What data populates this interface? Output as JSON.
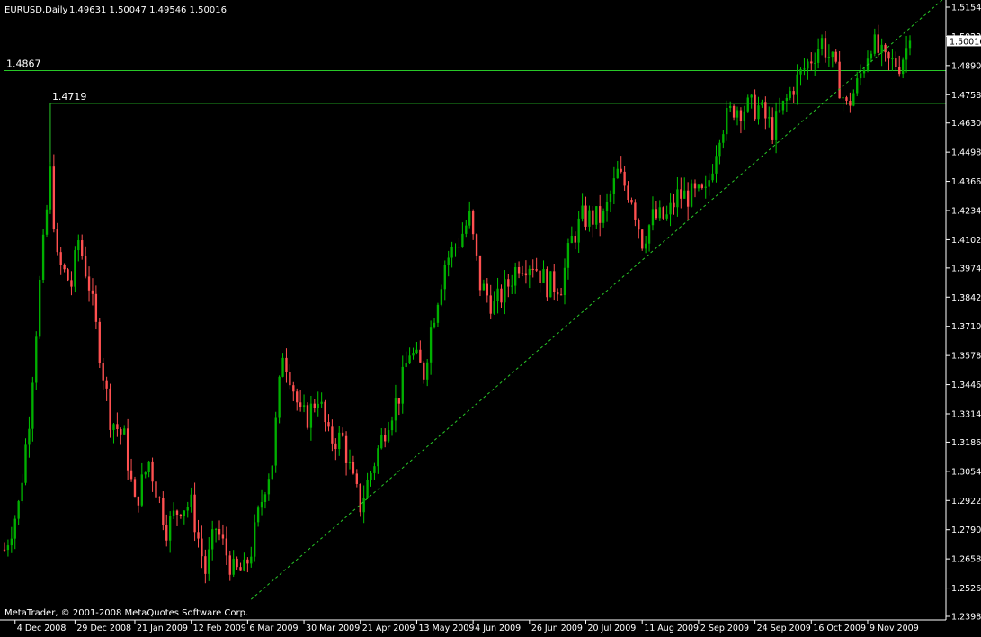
{
  "header": {
    "symbol_label": "EURUSD,Daily",
    "ohlc": "1.49631 1.50047 1.49546 1.50016"
  },
  "footer": {
    "copyright": "MetaTrader, © 2001-2008 MetaQuotes Software Corp."
  },
  "colors": {
    "background": "#000000",
    "bull_candle": "#00b000",
    "bear_candle": "#ff5050",
    "wick_bull": "#00c800",
    "wick_bear": "#ff5050",
    "axis": "#ffffff",
    "hline": "#28c828",
    "trendline": "#28c828"
  },
  "chart_data": {
    "type": "candlestick",
    "symbol": "EURUSD",
    "timeframe": "Daily",
    "last_price": "1.50016",
    "ylim": [
      1.2398,
      1.5154
    ],
    "y_ticks": [
      "1.51540",
      "1.50220",
      "1.48900",
      "1.47580",
      "1.46300",
      "1.44980",
      "1.43660",
      "1.42340",
      "1.41020",
      "1.39740",
      "1.38420",
      "1.37100",
      "1.35780",
      "1.34460",
      "1.33140",
      "1.31860",
      "1.30540",
      "1.29220",
      "1.27900",
      "1.26580",
      "1.25260",
      "1.23980"
    ],
    "x_ticks": [
      "4 Dec 2008",
      "29 Dec 2008",
      "21 Jan 2009",
      "12 Feb 2009",
      "6 Mar 2009",
      "30 Mar 2009",
      "21 Apr 2009",
      "13 May 2009",
      "4 Jun 2009",
      "26 Jun 2009",
      "20 Jul 2009",
      "11 Aug 2009",
      "2 Sep 2009",
      "24 Sep 2009",
      "16 Oct 2009",
      "9 Nov 2009"
    ],
    "horizontal_lines": [
      {
        "label": "1.4867",
        "price": 1.4867,
        "start_date": "1 Dec 2008"
      },
      {
        "label": "1.4719",
        "price": 1.4719,
        "start_date": "18 Dec 2008"
      }
    ],
    "trendline": {
      "style": "dashed",
      "from": {
        "date": "9 Mar 2009",
        "price": 1.2475
      },
      "to": {
        "date": "25 Nov 2009",
        "price": 1.506
      }
    },
    "close_path": [
      {
        "date": "1 Dec 2008",
        "close": 1.27
      },
      {
        "date": "5 Dec 2008",
        "close": 1.29
      },
      {
        "date": "10 Dec 2008",
        "close": 1.33
      },
      {
        "date": "15 Dec 2008",
        "close": 1.39
      },
      {
        "date": "18 Dec 2008",
        "close": 1.44
      },
      {
        "date": "22 Dec 2008",
        "close": 1.4
      },
      {
        "date": "26 Dec 2008",
        "close": 1.39
      },
      {
        "date": "30 Dec 2008",
        "close": 1.41
      },
      {
        "date": "2 Jan 2009",
        "close": 1.39
      },
      {
        "date": "7 Jan 2009",
        "close": 1.36
      },
      {
        "date": "12 Jan 2009",
        "close": 1.33
      },
      {
        "date": "16 Jan 2009",
        "close": 1.32
      },
      {
        "date": "21 Jan 2009",
        "close": 1.29
      },
      {
        "date": "27 Jan 2009",
        "close": 1.31
      },
      {
        "date": "3 Feb 2009",
        "close": 1.28
      },
      {
        "date": "9 Feb 2009",
        "close": 1.29
      },
      {
        "date": "12 Feb 2009",
        "close": 1.29
      },
      {
        "date": "18 Feb 2009",
        "close": 1.26
      },
      {
        "date": "23 Feb 2009",
        "close": 1.28
      },
      {
        "date": "2 Mar 2009",
        "close": 1.26
      },
      {
        "date": "5 Mar 2009",
        "close": 1.26
      },
      {
        "date": "9 Mar 2009",
        "close": 1.27
      },
      {
        "date": "13 Mar 2009",
        "close": 1.3
      },
      {
        "date": "17 Mar 2009",
        "close": 1.31
      },
      {
        "date": "20 Mar 2009",
        "close": 1.36
      },
      {
        "date": "24 Mar 2009",
        "close": 1.35
      },
      {
        "date": "27 Mar 2009",
        "close": 1.33
      },
      {
        "date": "31 Mar 2009",
        "close": 1.33
      },
      {
        "date": "3 Apr 2009",
        "close": 1.34
      },
      {
        "date": "8 Apr 2009",
        "close": 1.32
      },
      {
        "date": "14 Apr 2009",
        "close": 1.32
      },
      {
        "date": "17 Apr 2009",
        "close": 1.3
      },
      {
        "date": "21 Apr 2009",
        "close": 1.29
      },
      {
        "date": "27 Apr 2009",
        "close": 1.31
      },
      {
        "date": "1 May 2009",
        "close": 1.33
      },
      {
        "date": "6 May 2009",
        "close": 1.34
      },
      {
        "date": "11 May 2009",
        "close": 1.36
      },
      {
        "date": "15 May 2009",
        "close": 1.35
      },
      {
        "date": "19 May 2009",
        "close": 1.37
      },
      {
        "date": "25 May 2009",
        "close": 1.4
      },
      {
        "date": "29 May 2009",
        "close": 1.41
      },
      {
        "date": "3 Jun 2009",
        "close": 1.42
      },
      {
        "date": "8 Jun 2009",
        "close": 1.39
      },
      {
        "date": "12 Jun 2009",
        "close": 1.38
      },
      {
        "date": "18 Jun 2009",
        "close": 1.39
      },
      {
        "date": "23 Jun 2009",
        "close": 1.4
      },
      {
        "date": "29 Jun 2009",
        "close": 1.4
      },
      {
        "date": "3 Jul 2009",
        "close": 1.39
      },
      {
        "date": "9 Jul 2009",
        "close": 1.39
      },
      {
        "date": "14 Jul 2009",
        "close": 1.41
      },
      {
        "date": "17 Jul 2009",
        "close": 1.42
      },
      {
        "date": "23 Jul 2009",
        "close": 1.42
      },
      {
        "date": "27 Jul 2009",
        "close": 1.42
      },
      {
        "date": "31 Jul 2009",
        "close": 1.44
      },
      {
        "date": "6 Aug 2009",
        "close": 1.43
      },
      {
        "date": "11 Aug 2009",
        "close": 1.41
      },
      {
        "date": "14 Aug 2009",
        "close": 1.42
      },
      {
        "date": "20 Aug 2009",
        "close": 1.42
      },
      {
        "date": "25 Aug 2009",
        "close": 1.43
      },
      {
        "date": "31 Aug 2009",
        "close": 1.43
      },
      {
        "date": "4 Sep 2009",
        "close": 1.43
      },
      {
        "date": "10 Sep 2009",
        "close": 1.46
      },
      {
        "date": "16 Sep 2009",
        "close": 1.47
      },
      {
        "date": "21 Sep 2009",
        "close": 1.47
      },
      {
        "date": "25 Sep 2009",
        "close": 1.47
      },
      {
        "date": "1 Oct 2009",
        "close": 1.46
      },
      {
        "date": "6 Oct 2009",
        "close": 1.47
      },
      {
        "date": "9 Oct 2009",
        "close": 1.48
      },
      {
        "date": "15 Oct 2009",
        "close": 1.49
      },
      {
        "date": "21 Oct 2009",
        "close": 1.5
      },
      {
        "date": "26 Oct 2009",
        "close": 1.49
      },
      {
        "date": "30 Oct 2009",
        "close": 1.47
      },
      {
        "date": "4 Nov 2009",
        "close": 1.48
      },
      {
        "date": "10 Nov 2009",
        "close": 1.5
      },
      {
        "date": "16 Nov 2009",
        "close": 1.49
      },
      {
        "date": "20 Nov 2009",
        "close": 1.49
      },
      {
        "date": "25 Nov 2009",
        "close": 1.5002
      }
    ]
  }
}
